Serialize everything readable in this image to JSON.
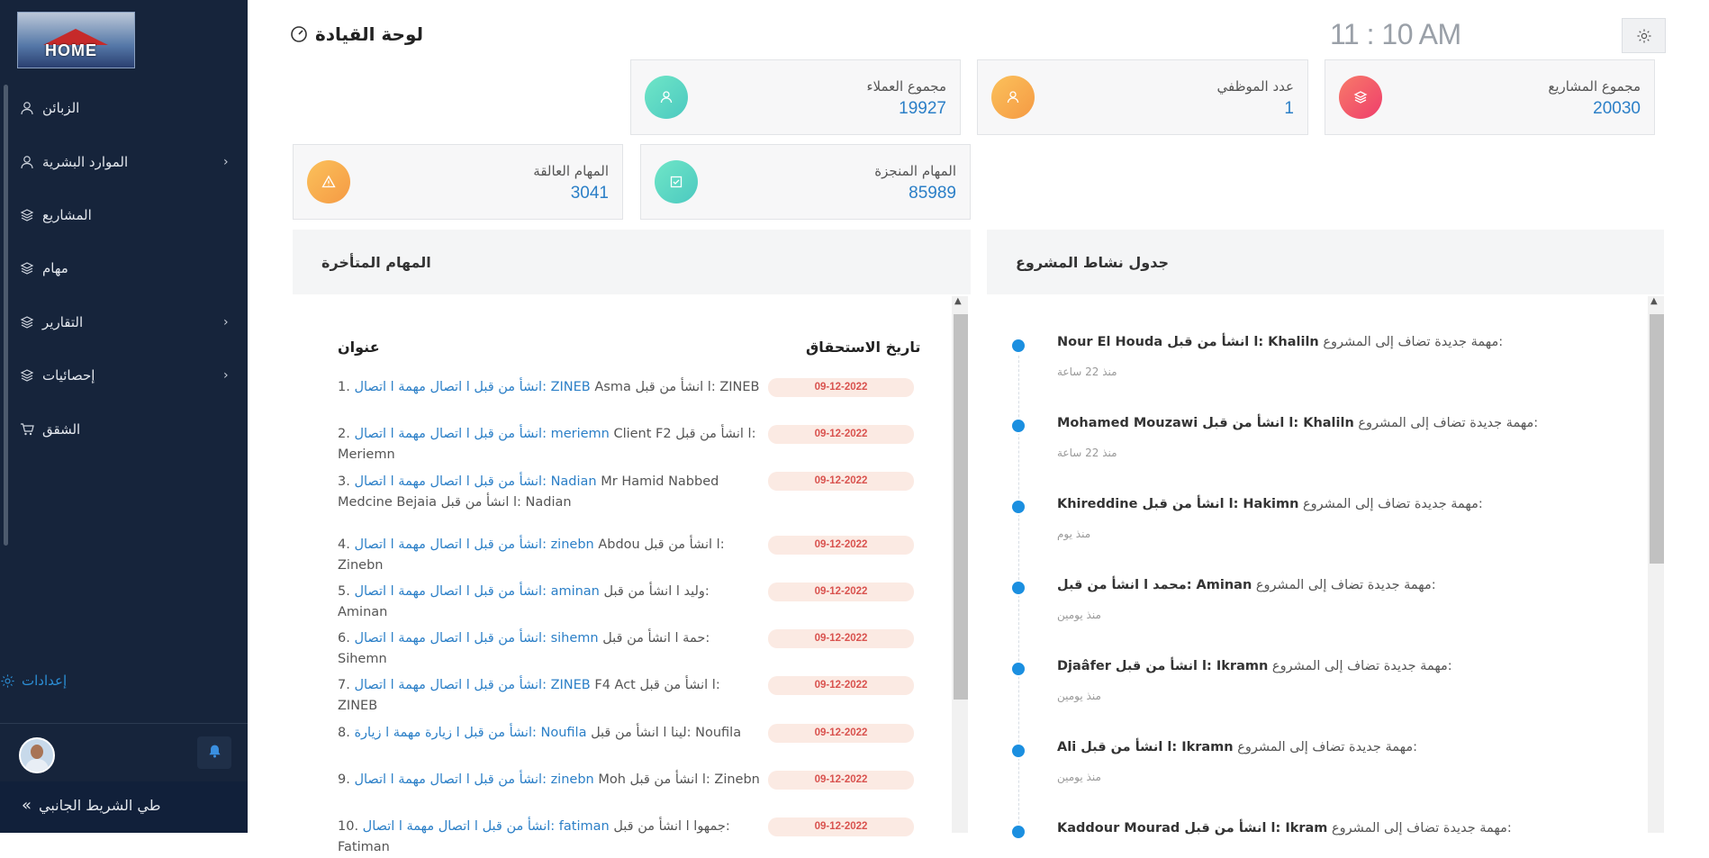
{
  "sidebar": {
    "logo_text": "HOME",
    "items": [
      {
        "label": "الزبائن",
        "icon": "user-icon",
        "has_children": false
      },
      {
        "label": "الموارد البشرية",
        "icon": "user-icon",
        "has_children": true
      },
      {
        "label": "المشاريع",
        "icon": "layers-icon",
        "has_children": false
      },
      {
        "label": "مهام",
        "icon": "layers-icon",
        "has_children": false
      },
      {
        "label": "التقارير",
        "icon": "layers-icon",
        "has_children": true
      },
      {
        "label": "إحصائيات",
        "icon": "layers-icon",
        "has_children": true
      },
      {
        "label": "الشقق",
        "icon": "cart-icon",
        "has_children": false
      }
    ],
    "settings_label": "إعدادات",
    "collapse_label": "طي الشريط الجانبي"
  },
  "header": {
    "title": "لوحة القيادة",
    "clock": "11 : 10 AM"
  },
  "stats": {
    "projects": {
      "label": "مجموع المشاريع",
      "value": "20030",
      "color": "#f0566b"
    },
    "employees": {
      "label": "عدد الموظفي",
      "value": "1",
      "color": "#f5a24a"
    },
    "clients": {
      "label": "مجموع العملاء",
      "value": "19927",
      "color": "#4fd9b8"
    },
    "done_tasks": {
      "label": "المهام المنجزة",
      "value": "85989",
      "color": "#4fd9b8"
    },
    "pending_tasks": {
      "label": "المهام العالقة",
      "value": "3041",
      "color": "#f5a24a"
    }
  },
  "late_tasks": {
    "title": "المهام المتأخرة",
    "col_title": "عنوان",
    "col_due": "تاريخ الاستحقاق",
    "rows": [
      {
        "num": "1.",
        "link": "انشأ من قبل ا اتصال مهمة ا اتصال: ZINEB",
        "rest": "Asma ا انشأ من قبل: ZINEB",
        "due": "09-12-2022"
      },
      {
        "num": "2.",
        "link": "انشأ من قبل ا اتصال مهمة ا اتصال: meriemn",
        "rest": "Client F2 ا انشأ من قبل: Meriemn",
        "due": "09-12-2022"
      },
      {
        "num": "3.",
        "link": "انشأ من قبل ا اتصال مهمة ا اتصال: Nadian",
        "rest": "Mr Hamid Nabbed Medcine Bejaia ا انشأ من قبل: Nadian",
        "due": "09-12-2022"
      },
      {
        "num": "4.",
        "link": "انشأ من قبل ا اتصال مهمة ا اتصال: zinebn",
        "rest": "Abdou ا انشأ من قبل: Zinebn",
        "due": "09-12-2022"
      },
      {
        "num": "5.",
        "link": "انشأ من قبل ا اتصال مهمة ا اتصال: aminan",
        "rest": "وليد ا انشأ من قبل: Aminan",
        "due": "09-12-2022"
      },
      {
        "num": "6.",
        "link": "انشأ من قبل ا اتصال مهمة ا اتصال: sihemn",
        "rest": "حمة ا انشأ من قبل: Sihemn",
        "due": "09-12-2022"
      },
      {
        "num": "7.",
        "link": "انشأ من قبل ا اتصال مهمة ا اتصال: ZINEB",
        "rest": "F4 Act ا انشأ من قبل: ZINEB",
        "due": "09-12-2022"
      },
      {
        "num": "8.",
        "link": "انشأ من قبل ا زيارة مهمة ا زيارة: Noufila",
        "rest": "لينا ا انشأ من قبل: Noufila",
        "due": "09-12-2022"
      },
      {
        "num": "9.",
        "link": "انشأ من قبل ا اتصال مهمة ا اتصال: zinebn",
        "rest": "Moh ا انشأ من قبل: Zinebn",
        "due": "09-12-2022"
      },
      {
        "num": "10.",
        "link": "انشأ من قبل ا اتصال مهمة ا اتصال: fatiman",
        "rest": "جمهوا ا انشأ من قبل: Fatiman",
        "due": "09-12-2022"
      }
    ]
  },
  "activity": {
    "title": "جدول نشاط المشروع",
    "items": [
      {
        "who": "Nour El Houda ا انشأ من قبل: Khaliln",
        "msg": "مهمة جديدة تضاف إلى المشروع:",
        "time": "منذ 22 ساعة"
      },
      {
        "who": "Mohamed Mouzawi ا انشأ من قبل: Khaliln",
        "msg": "مهمة جديدة تضاف إلى المشروع:",
        "time": "منذ 22 ساعة"
      },
      {
        "who": "Khireddine ا انشأ من قبل: Hakimn",
        "msg": "مهمة جديدة تضاف إلى المشروع:",
        "time": "منذ يوم"
      },
      {
        "who": "محمد ا انشأ من قبل: Aminan",
        "msg": "مهمة جديدة تضاف إلى المشروع:",
        "time": "منذ يومين"
      },
      {
        "who": "Djaâfer ا انشأ من قبل: Ikramn",
        "msg": "مهمة جديدة تضاف إلى المشروع:",
        "time": "منذ يومين"
      },
      {
        "who": "Ali ا انشأ من قبل: Ikramn",
        "msg": "مهمة جديدة تضاف إلى المشروع:",
        "time": "منذ يومين"
      },
      {
        "who": "Kaddour Mourad ا انشأ من قبل: Ikram",
        "msg": "مهمة جديدة تضاف إلى المشروع:",
        "time": ""
      }
    ]
  }
}
